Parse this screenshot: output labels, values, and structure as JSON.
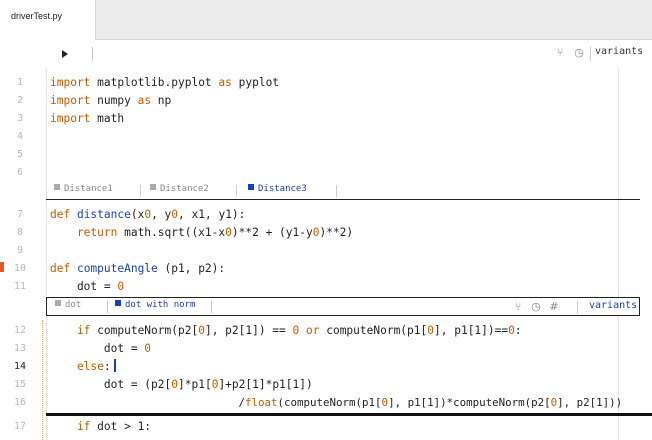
{
  "tab": {
    "title": "driverTest.py"
  },
  "toolbar": {
    "variants_label": "variants",
    "branch_icon": "branch-icon",
    "history_icon": "history-icon"
  },
  "lines": {
    "l1": {
      "n": "1",
      "a": "import",
      "b": " matplotlib.pyplot ",
      "c": "as",
      "d": " pyplot"
    },
    "l2": {
      "n": "2",
      "a": "import",
      "b": " numpy ",
      "c": "as",
      "d": " np"
    },
    "l3": {
      "n": "3",
      "a": "import",
      "b": " math"
    },
    "l4": {
      "n": "4"
    },
    "l5": {
      "n": "5"
    },
    "l6": {
      "n": "6"
    },
    "l7": {
      "n": "7",
      "a": "def ",
      "b": "distance",
      "c": "(x",
      "d": "0",
      "e": ", y",
      "f": "0",
      "g": ", x1, y1):"
    },
    "l8": {
      "n": "8",
      "a": "    return",
      "b": " math.sqrt((x1-x",
      "c": "0",
      "d": ")**2 + (y1-y",
      "e": "0",
      "f": ")**2)"
    },
    "l9": {
      "n": "9"
    },
    "l10": {
      "n": "10",
      "a": "def ",
      "b": "computeAngle",
      "c": " (p1, p2):"
    },
    "l11": {
      "n": "11",
      "a": "    dot = ",
      "b": "0"
    },
    "l12": {
      "n": "12",
      "a": "    if",
      "b": " computeNorm(p2[",
      "c": "0",
      "d": "], p2[1]) == ",
      "e": "0",
      "f": " or",
      "g": " computeNorm(p1[",
      "h": "0",
      "i": "], p1[1])==",
      "j": "0",
      "k": ":"
    },
    "l13": {
      "n": "13",
      "a": "        dot = ",
      "b": "0"
    },
    "l14": {
      "n": "14",
      "a": "    else",
      "b": ":"
    },
    "l15": {
      "n": "15",
      "a": "        dot = (p2[",
      "b": "0",
      "c": "]*p1[",
      "d": "0",
      "e": "]+p2[1]*p1[1])"
    },
    "l16": {
      "n": "16",
      "a": "                             /",
      "b": "float",
      "c": "(computeNorm(p1[",
      "d": "0",
      "e": "], p1[1])*computeNorm(p2[",
      "f": "0",
      "g": "], p2[1]))"
    },
    "l17": {
      "n": "17",
      "a": "    if",
      "b": " dot > 1:"
    }
  },
  "variant_tabs_1": [
    "Distance1",
    "Distance2",
    "Distance3"
  ],
  "variant_tabs_2": {
    "tab1": "dot",
    "tab2": "dot with norm",
    "variants_label": "variants",
    "hash": "#"
  }
}
